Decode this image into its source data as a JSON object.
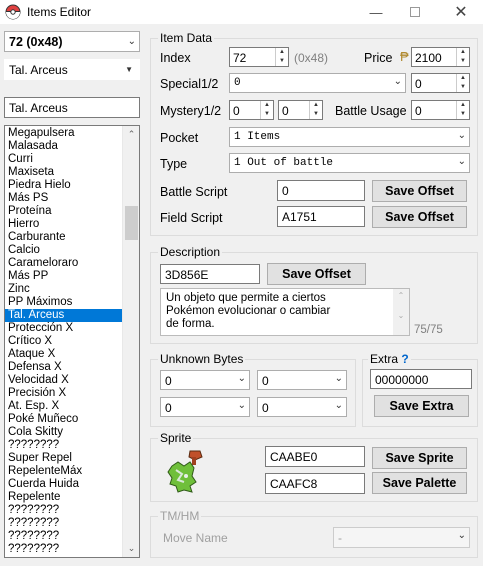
{
  "window": {
    "title": "Items Editor"
  },
  "left": {
    "item_select": "72  (0x48)",
    "search_combo": "Tal. Arceus",
    "search_input": "Tal. Arceus",
    "items": [
      "Megapulsera",
      "Malasada",
      "Curri",
      "Maxiseta",
      "Piedra Hielo",
      "Más PS",
      "Proteína",
      "Hierro",
      "Carburante",
      "Calcio",
      "Carameloraro",
      "Más PP",
      "Zinc",
      "PP Máximos",
      "Tal. Arceus",
      "Protección X",
      "Crítico X",
      "Ataque X",
      "Defensa X",
      "Velocidad X",
      "Precisión X",
      "At. Esp. X",
      "Poké Muñeco",
      "Cola Skitty",
      "????????",
      "Super Repel",
      "RepelenteMáx",
      "Cuerda Huida",
      "Repelente",
      "????????",
      "????????",
      "????????",
      "????????"
    ],
    "selected_item": "Tal. Arceus"
  },
  "item_data": {
    "group_label": "Item Data",
    "index_label": "Index",
    "index_value": "72",
    "index_hex": "(0x48)",
    "price_label": "Price",
    "price_value": "2100",
    "special_label": "Special1/2",
    "special1_value": "0",
    "special2_value": "0",
    "mystery_label": "Mystery1/2",
    "mystery1_value": "0",
    "mystery2_value": "0",
    "battle_usage_label": "Battle Usage",
    "battle_usage_value": "0",
    "pocket_label": "Pocket",
    "pocket_value": "1 Items",
    "type_label": "Type",
    "type_value": "1 Out of battle",
    "battle_script_label": "Battle Script",
    "battle_script_value": "0",
    "field_script_label": "Field Script",
    "field_script_value": "A1751",
    "save_offset_label": "Save Offset"
  },
  "description": {
    "group_label": "Description",
    "offset_value": "3D856E",
    "save_offset_label": "Save Offset",
    "text_line1": "Un objeto que permite a ciertos",
    "text_line2": "Pokémon evolucionar o cambiar",
    "text_line3": "de forma.",
    "char_count": "75/75"
  },
  "unknown_bytes": {
    "group_label": "Unknown Bytes",
    "values": [
      "0",
      "0",
      "0",
      "0"
    ]
  },
  "extra": {
    "group_label": "Extra",
    "help": "?",
    "value": "00000000",
    "save_label": "Save Extra"
  },
  "sprite": {
    "group_label": "Sprite",
    "sprite_offset": "CAABE0",
    "palette_offset": "CAAFC8",
    "save_sprite_label": "Save Sprite",
    "save_palette_label": "Save Palette"
  },
  "tmhm": {
    "group_label": "TM/HM",
    "move_name_label": "Move Name",
    "move_value": "-"
  },
  "colors": {
    "selection": "#0078d7",
    "help": "#0066cc"
  }
}
